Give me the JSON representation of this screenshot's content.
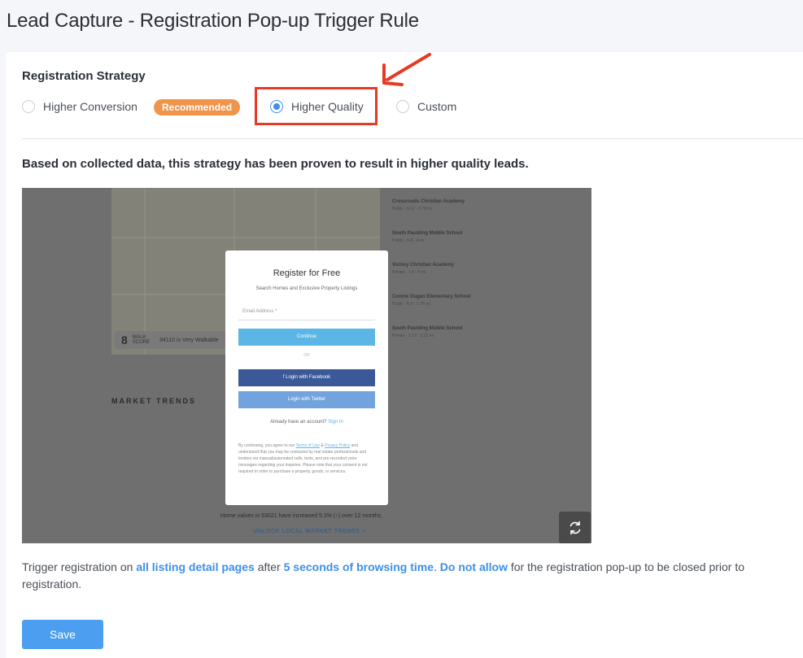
{
  "page": {
    "title": "Lead Capture - Registration Pop-up Trigger Rule"
  },
  "strategy": {
    "section_title": "Registration Strategy",
    "options": [
      {
        "label": "Higher Conversion",
        "selected": false
      },
      {
        "label": "Higher Quality",
        "selected": true
      },
      {
        "label": "Custom",
        "selected": false
      }
    ],
    "badge": "Recommended",
    "description": "Based on collected data, this strategy has been proven to result in higher quality leads."
  },
  "preview": {
    "walk_score": {
      "number": "8",
      "label_1": "WALK",
      "label_2": "SCORE",
      "desc": "94110 is Very Walkable"
    },
    "schools": [
      {
        "name": "Crossroads Christian Academy",
        "meta": "Public · 9-12 · 0.78 mi"
      },
      {
        "name": "South Paulding Middle School",
        "meta": "Public · 6-8 · 4 mi"
      },
      {
        "name": "Victory Christian Academy",
        "meta": "Private · 1-6 · 4 mi"
      },
      {
        "name": "Connie Dugan Elementary School",
        "meta": "Public · K-5 · 0.78 mi"
      },
      {
        "name": "South Paulding Middle School",
        "meta": "Private · 1-12 · 3.12 mi"
      }
    ],
    "market_trends": "MARKET TRENDS",
    "home_values": "Home values in 93021 have increased 5.3% (↑) over 12 months.",
    "unlock": "UNLOCK LOCAL MARKET TRENDS >",
    "modal": {
      "title": "Register for Free",
      "subtitle": "Search Homes and Exclusive Property Listings",
      "email_placeholder": "Email Address *",
      "continue": "Continue",
      "or": "OR",
      "facebook": "f  Login with Facebook",
      "twitter": "Login with Twitter",
      "account_prefix": "Already have an account?",
      "sign_in": "Sign In",
      "legal_1": "By continuing, you agree to our",
      "terms": "Terms of Use",
      "legal_2": "&",
      "privacy": "Privacy Policy",
      "legal_3": "and understand that you may be contacted by real estate professionals and lenders via manual/automated calls, texts, and pre-recorded voice messages regarding your inquiries. Please note that your consent is not required in order to purchase a property, goods, or services."
    }
  },
  "trigger": {
    "t1": "Trigger registration on ",
    "h1": "all listing detail pages",
    "t2": " after ",
    "h2": "5 seconds of browsing time",
    "t3": ". ",
    "h3": "Do not allow",
    "t4": " for the registration pop-up to be closed prior to registration."
  },
  "actions": {
    "save": "Save"
  },
  "colors": {
    "accent": "#3d8fe8",
    "badge": "#f0944a",
    "annotation": "#e53a23",
    "save_button": "#4c9ef0"
  },
  "icons": {
    "refresh": "refresh-icon",
    "arrow": "annotation-arrow"
  }
}
